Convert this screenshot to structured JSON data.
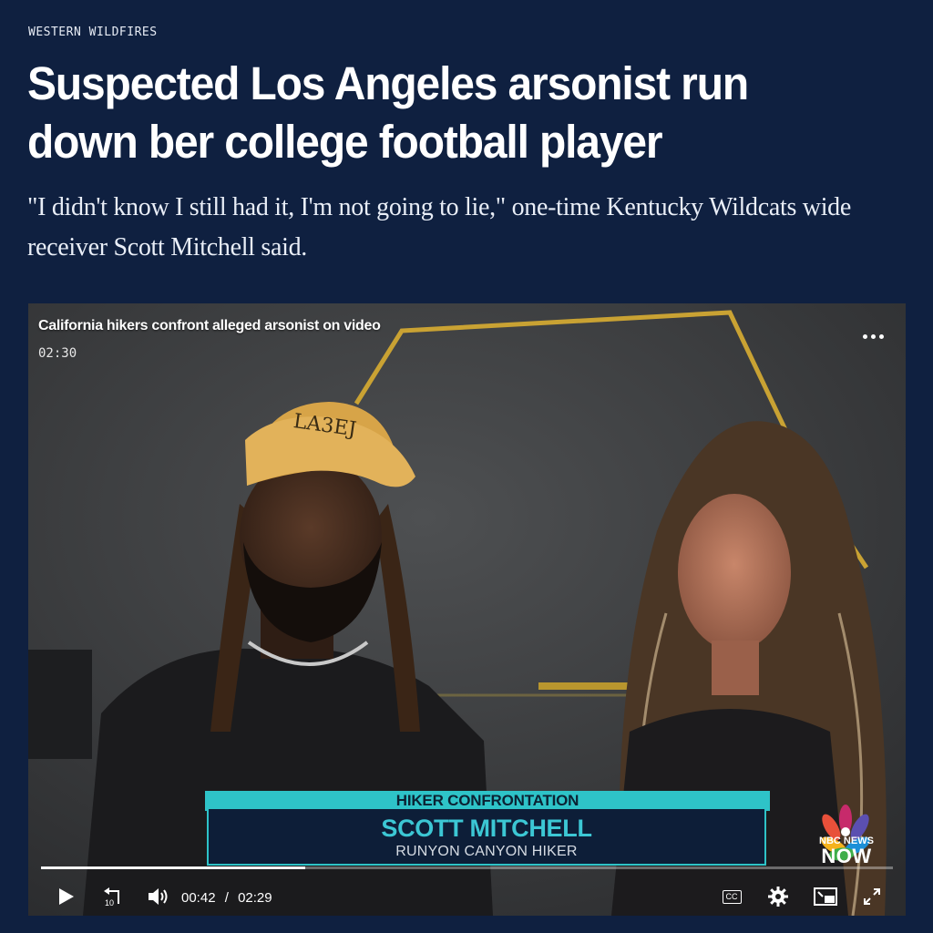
{
  "article": {
    "section_label": "WESTERN WILDFIRES",
    "headline": "Suspected Los Angeles arsonist run down ber college football player",
    "dek": "\"I didn't know I still had it, I'm not going to lie,\" one-time Kentucky Wildcats wide receiver Scott Mitchell said."
  },
  "video": {
    "title": "California hikers confront alleged arsonist on video",
    "duration": "02:30",
    "lower_third": {
      "topic": "HIKER CONFRONTATION",
      "name": "SCOTT MITCHELL",
      "role": "RUNYON CANYON HIKER"
    },
    "network_logo": {
      "line1": "NBC NEWS",
      "line2": "NOW"
    },
    "playback": {
      "current_time": "00:42",
      "separator": "/",
      "total_time": "02:29",
      "progress_fraction": 0.31
    },
    "controls": {
      "play_icon": "play-icon",
      "rewind_icon": "rewind-10-icon",
      "rewind_label": "10",
      "volume_icon": "volume-icon",
      "cc_label": "CC",
      "settings_icon": "gear-icon",
      "pip_icon": "picture-in-picture-icon",
      "fullscreen_icon": "fullscreen-icon"
    }
  },
  "colors": {
    "page_background": "#0f2040",
    "lower_third_accent": "#2ec3c8",
    "lower_third_box": "#0d1e38"
  }
}
